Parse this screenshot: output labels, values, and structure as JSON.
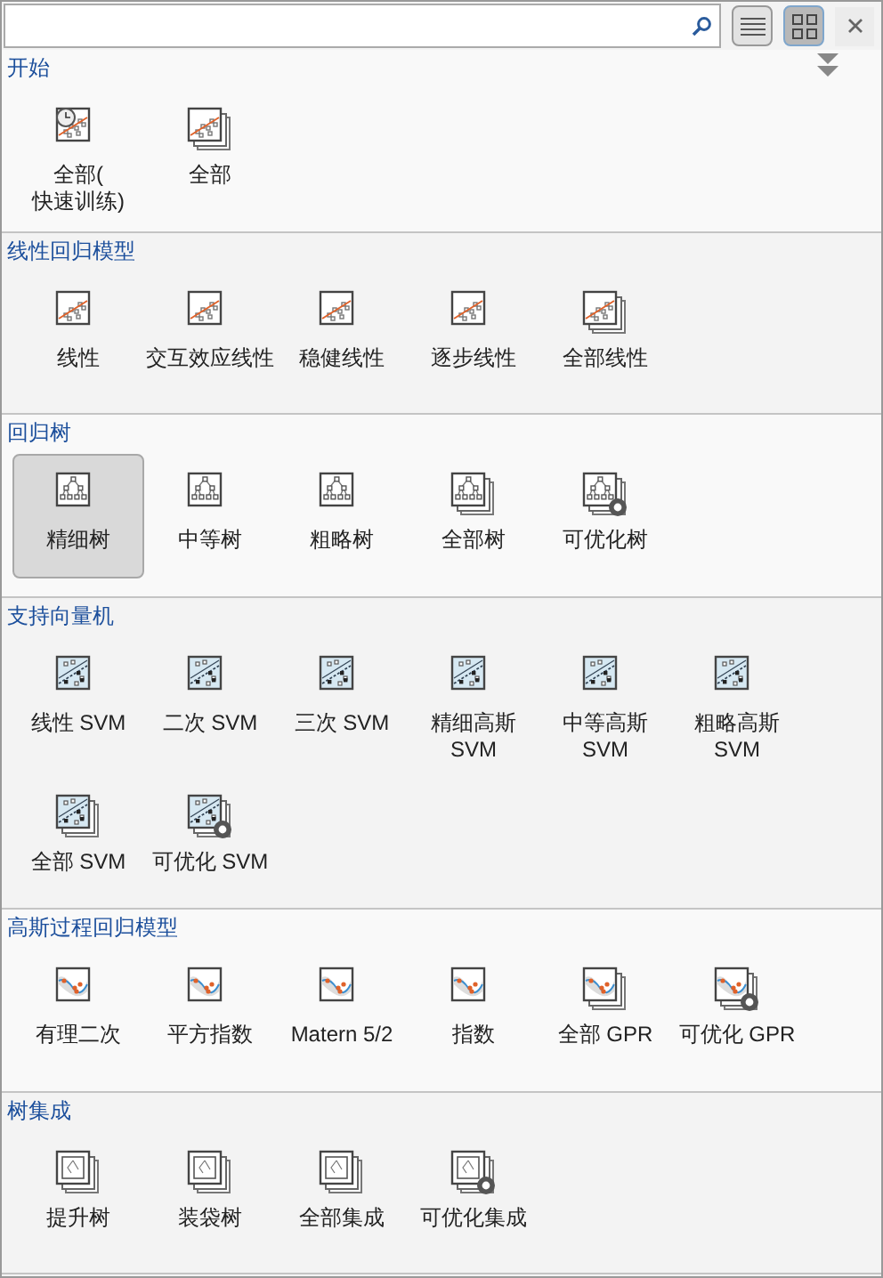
{
  "view_buttons": [
    {
      "kind": "list",
      "selected": false
    },
    {
      "kind": "grid",
      "selected": true
    }
  ],
  "sections": [
    {
      "title": "开始",
      "kind": "scatter",
      "items": [
        {
          "label": "全部(\n快速训练)",
          "kind": "quick",
          "selected": false
        },
        {
          "label": "全部",
          "kind": "all",
          "selected": false
        }
      ]
    },
    {
      "title": "线性回归模型",
      "kind": "scatter",
      "items": [
        {
          "label": "线性",
          "kind": "single",
          "selected": false
        },
        {
          "label": "交互效应线性",
          "kind": "single",
          "selected": false
        },
        {
          "label": "稳健线性",
          "kind": "single",
          "selected": false
        },
        {
          "label": "逐步线性",
          "kind": "single",
          "selected": false
        },
        {
          "label": "全部线性",
          "kind": "all",
          "selected": false
        }
      ]
    },
    {
      "title": "回归树",
      "kind": "tree",
      "items": [
        {
          "label": "精细树",
          "kind": "single",
          "selected": true
        },
        {
          "label": "中等树",
          "kind": "single",
          "selected": false
        },
        {
          "label": "粗略树",
          "kind": "single",
          "selected": false
        },
        {
          "label": "全部树",
          "kind": "all",
          "selected": false
        },
        {
          "label": "可优化树",
          "kind": "optimizable",
          "selected": false
        }
      ]
    },
    {
      "title": "支持向量机",
      "kind": "svm",
      "items": [
        {
          "label": "线性 SVM",
          "kind": "single",
          "selected": false
        },
        {
          "label": "二次 SVM",
          "kind": "single",
          "selected": false
        },
        {
          "label": "三次 SVM",
          "kind": "single",
          "selected": false
        },
        {
          "label": "精细高斯 SVM",
          "kind": "single",
          "selected": false
        },
        {
          "label": "中等高斯 SVM",
          "kind": "single",
          "selected": false
        },
        {
          "label": "粗略高斯 SVM",
          "kind": "single",
          "selected": false
        },
        {
          "label": "全部 SVM",
          "kind": "all",
          "selected": false
        },
        {
          "label": "可优化 SVM",
          "kind": "optimizable",
          "selected": false
        }
      ]
    },
    {
      "title": "高斯过程回归模型",
      "kind": "gpr",
      "items": [
        {
          "label": "有理二次",
          "kind": "single",
          "selected": false
        },
        {
          "label": "平方指数",
          "kind": "single",
          "selected": false
        },
        {
          "label": "Matern 5/2",
          "kind": "single",
          "selected": false
        },
        {
          "label": "指数",
          "kind": "single",
          "selected": false
        },
        {
          "label": "全部 GPR",
          "kind": "all",
          "selected": false
        },
        {
          "label": "可优化 GPR",
          "kind": "optimizable",
          "selected": false
        }
      ]
    },
    {
      "title": "树集成",
      "kind": "ensemble",
      "items": [
        {
          "label": "提升树",
          "kind": "all",
          "selected": false
        },
        {
          "label": "装袋树",
          "kind": "all",
          "selected": false
        },
        {
          "label": "全部集成",
          "kind": "all",
          "selected": false
        },
        {
          "label": "可优化集成",
          "kind": "optimizable",
          "selected": false
        }
      ]
    }
  ]
}
